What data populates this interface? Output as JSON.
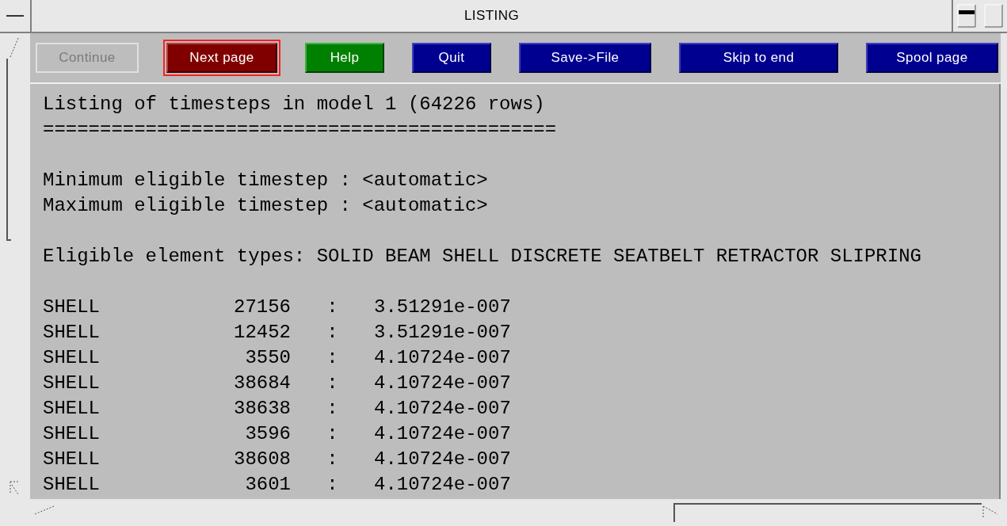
{
  "window": {
    "title": "LISTING"
  },
  "buttons": [
    {
      "label": "Continue",
      "disabled": true,
      "focused": false
    },
    {
      "label": "Next page",
      "kind": "danger",
      "disabled": false,
      "focused": true
    },
    {
      "label": "Help",
      "kind": "help",
      "disabled": false,
      "focused": false
    },
    {
      "label": "Quit",
      "kind": "action",
      "disabled": false,
      "focused": false
    },
    {
      "label": "Save->File",
      "kind": "action",
      "disabled": false,
      "focused": false
    },
    {
      "label": "Skip to end",
      "kind": "action",
      "disabled": false,
      "focused": false
    },
    {
      "label": "Spool page",
      "kind": "action",
      "disabled": false,
      "focused": false
    }
  ],
  "listing": {
    "paragraphs": [
      [
        "Listing of timesteps in model 1 (64226 rows)",
        "============================================="
      ],
      [
        "Minimum eligible timestep : <automatic>",
        "Maximum eligible timestep : <automatic>"
      ],
      [
        "Eligible element types: SOLID BEAM SHELL DISCRETE SEATBELT RETRACTOR SLIPRING"
      ]
    ],
    "rows": [
      {
        "type": "SHELL",
        "id": "27156",
        "separator": ":",
        "timestep": "3.51291e-007"
      },
      {
        "type": "SHELL",
        "id": "12452",
        "separator": ":",
        "timestep": "3.51291e-007"
      },
      {
        "type": "SHELL",
        "id": "3550",
        "separator": ":",
        "timestep": "4.10724e-007"
      },
      {
        "type": "SHELL",
        "id": "38684",
        "separator": ":",
        "timestep": "4.10724e-007"
      },
      {
        "type": "SHELL",
        "id": "38638",
        "separator": ":",
        "timestep": "4.10724e-007"
      },
      {
        "type": "SHELL",
        "id": "3596",
        "separator": ":",
        "timestep": "4.10724e-007"
      },
      {
        "type": "SHELL",
        "id": "38608",
        "separator": ":",
        "timestep": "4.10724e-007"
      },
      {
        "type": "SHELL",
        "id": "3601",
        "separator": ":",
        "timestep": "4.10724e-007"
      }
    ]
  }
}
